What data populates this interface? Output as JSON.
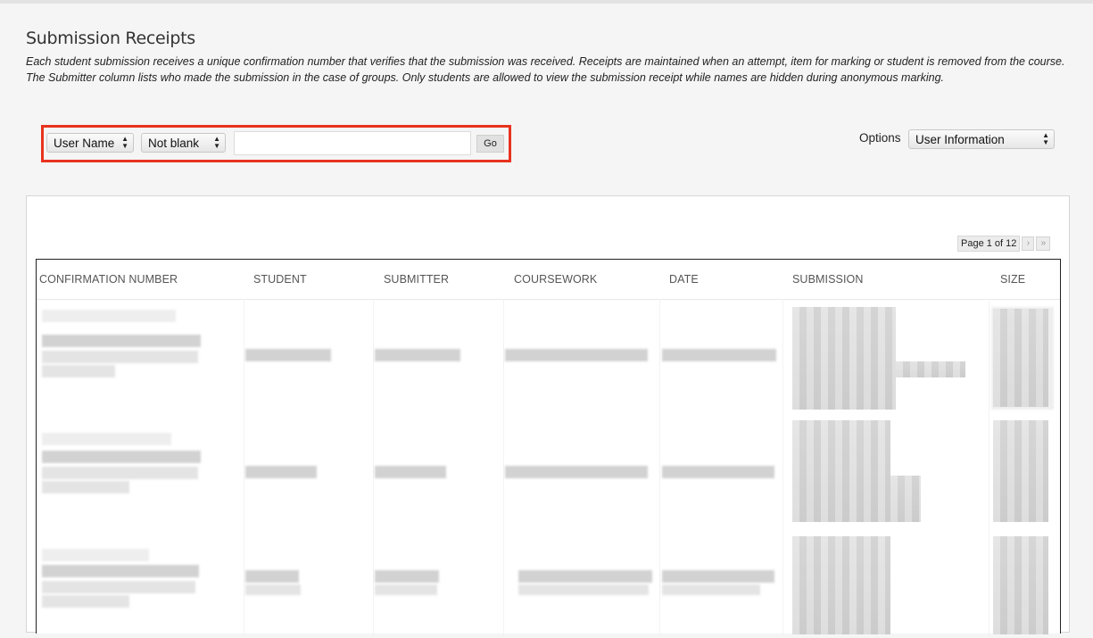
{
  "page": {
    "title": "Submission Receipts",
    "description": "Each student submission receives a unique confirmation number that verifies that the submission was received. Receipts are maintained when an attempt, item for marking or student is removed from the course. The Submitter column lists who made the submission in the case of groups. Only students are allowed to view the submission receipt while names are hidden during anonymous marking."
  },
  "filter": {
    "field_select": "User Name",
    "condition_select": "Not blank",
    "search_value": "",
    "go_label": "Go",
    "highlight_color": "#e8331f"
  },
  "options": {
    "label": "Options",
    "selected": "User Information"
  },
  "pager": {
    "text": "Page 1 of 12",
    "next_icon": "chevron-right-icon",
    "last_icon": "double-chevron-right-icon"
  },
  "table": {
    "columns": [
      "CONFIRMATION NUMBER",
      "STUDENT",
      "SUBMITTER",
      "COURSEWORK",
      "DATE",
      "SUBMISSION",
      "SIZE"
    ],
    "rows_note": "",
    "row_count_visible": 3
  }
}
